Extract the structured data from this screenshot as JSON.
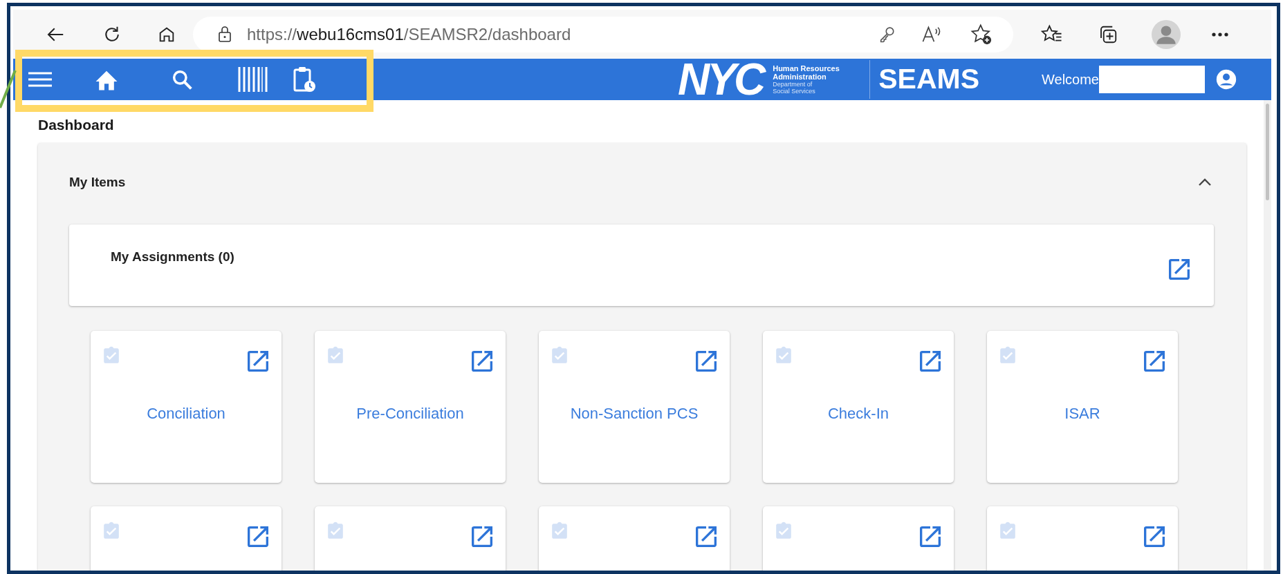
{
  "browser": {
    "url": {
      "scheme": "https://",
      "host": "webu16cms01",
      "path": "/SEAMSR2/dashboard"
    }
  },
  "header": {
    "logo_text": "NYC",
    "agency_lines": [
      "Human Resources",
      "Administration"
    ],
    "department_lines": [
      "Department of",
      "Social Services"
    ],
    "app_name": "SEAMS",
    "welcome": "Welcome"
  },
  "page_title": "Dashboard",
  "section": {
    "title": "My Items",
    "expanded": true
  },
  "assignments": {
    "title": "My Assignments (0)"
  },
  "tiles": [
    {
      "kind": "full",
      "label": "Conciliation"
    },
    {
      "kind": "full",
      "label": "Pre-Conciliation"
    },
    {
      "kind": "full",
      "label": "Non-Sanction PCS"
    },
    {
      "kind": "full",
      "label": "Check-In"
    },
    {
      "kind": "full",
      "label": "ISAR"
    },
    {
      "kind": "cut"
    },
    {
      "kind": "cut"
    },
    {
      "kind": "cut"
    },
    {
      "kind": "cut"
    },
    {
      "kind": "cut"
    }
  ]
}
